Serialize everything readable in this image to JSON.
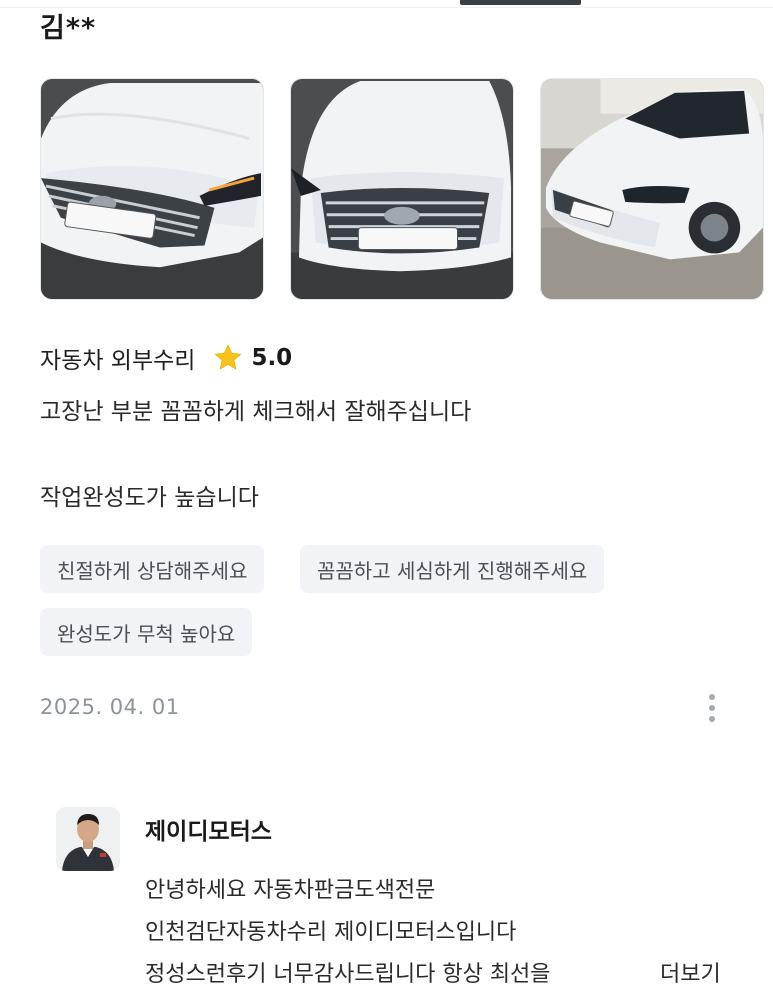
{
  "review": {
    "reviewer_name": "김**",
    "photos": [
      {
        "icon": "car-photo-front-1"
      },
      {
        "icon": "car-photo-front-2"
      },
      {
        "icon": "car-photo-side"
      }
    ],
    "service": "자동차 외부수리",
    "rating_icon": "star-icon",
    "rating": "5.0",
    "text_lines": [
      "고장난 부분  꼼꼼하게 체크해서 잘해주십니다",
      "작업완성도가 높습니다"
    ],
    "tags": [
      "친절하게 상담해주세요",
      "꼼꼼하고 세심하게 진행해주세요",
      "완성도가 무척 높아요"
    ],
    "date": "2025. 04. 01",
    "more_icon": "more-vertical-icon"
  },
  "reply": {
    "shop_name": "제이디모터스",
    "lines": [
      "안녕하세요 자동차판금도색전문",
      "인천검단자동차수리 제이디모터스입니다",
      "정성스런후기 너무감사드립니다 항상 최선을"
    ],
    "more_label": "더보기"
  },
  "colors": {
    "chip_bg": "#f1f3f6",
    "star": "#f7c21b",
    "muted": "#8d939b"
  }
}
